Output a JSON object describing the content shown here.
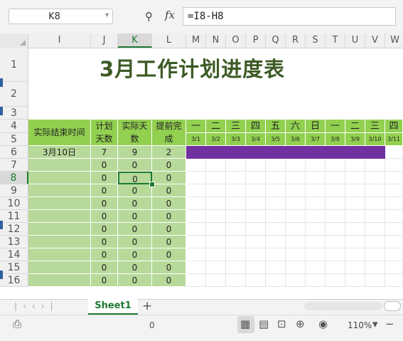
{
  "formula_bar": {
    "name_box": "K8",
    "fx": "fx",
    "formula": "=I8-H8"
  },
  "columns": [
    "I",
    "J",
    "K",
    "L",
    "M",
    "N",
    "O",
    "P",
    "Q",
    "R",
    "S",
    "T",
    "U",
    "V",
    "W"
  ],
  "active_column": "K",
  "rows": [
    "1",
    "2",
    "3",
    "4",
    "5",
    "6",
    "7",
    "8",
    "9",
    "10",
    "11",
    "12",
    "13",
    "14",
    "15",
    "16"
  ],
  "active_row": "8",
  "title": "3月工作计划进度表",
  "headers": {
    "actual_end": "实际结束时间",
    "plan_days": "计划天数",
    "actual_days": "实际天数",
    "ahead": "提前完成"
  },
  "weekdays": [
    "一",
    "二",
    "三",
    "四",
    "五",
    "六",
    "日",
    "一",
    "二",
    "三",
    "四"
  ],
  "dates": [
    "3/1",
    "3/2",
    "3/3",
    "3/4",
    "3/5",
    "3/6",
    "3/7",
    "3/8",
    "3/9",
    "3/10",
    "3/11"
  ],
  "data_rows": [
    {
      "end": "3月10日",
      "plan": "7",
      "actual": "9",
      "ahead": "2"
    },
    {
      "end": "",
      "plan": "0",
      "actual": "0",
      "ahead": "0"
    },
    {
      "end": "",
      "plan": "0",
      "actual": "0",
      "ahead": "0"
    },
    {
      "end": "",
      "plan": "0",
      "actual": "0",
      "ahead": "0"
    },
    {
      "end": "",
      "plan": "0",
      "actual": "0",
      "ahead": "0"
    },
    {
      "end": "",
      "plan": "0",
      "actual": "0",
      "ahead": "0"
    },
    {
      "end": "",
      "plan": "0",
      "actual": "0",
      "ahead": "0"
    },
    {
      "end": "",
      "plan": "0",
      "actual": "0",
      "ahead": "0"
    },
    {
      "end": "",
      "plan": "0",
      "actual": "0",
      "ahead": "0"
    },
    {
      "end": "",
      "plan": "0",
      "actual": "0",
      "ahead": "0"
    },
    {
      "end": "",
      "plan": "0",
      "actual": "0",
      "ahead": "0"
    }
  ],
  "gantt_days_filled": 10,
  "colors": {
    "accent": "#1e7a34",
    "header_green": "#92d050",
    "data_green": "#b7d99a",
    "gantt_bar": "#7030a0",
    "title": "#3c5a24"
  },
  "sheet_tab": "Sheet1",
  "status": {
    "value": "0",
    "zoom": "110%"
  }
}
